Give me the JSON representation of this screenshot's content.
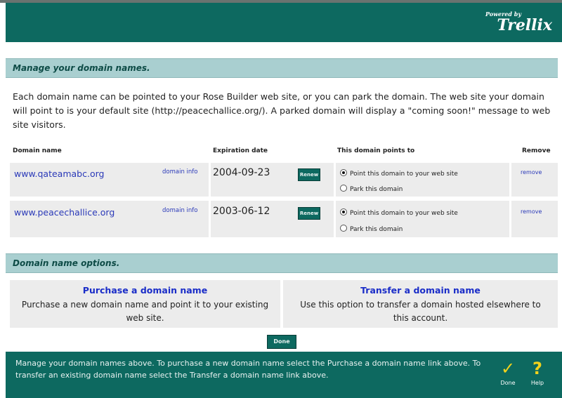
{
  "branding": {
    "powered": "Powered by",
    "brand": "Trellix"
  },
  "manage_section": {
    "title": "Manage your domain names.",
    "intro": "Each domain name can be pointed to your Rose Builder web site, or you can park the domain. The web site your domain will point to is your default site (http://peacechallice.org/). A parked domain will display a \"coming soon!\" message to web site visitors."
  },
  "table": {
    "headers": {
      "domain": "Domain name",
      "expiration": "Expiration date",
      "points": "This domain points to",
      "remove": "Remove"
    },
    "rows": [
      {
        "domain": "www.qateamabc.org",
        "info": "domain info",
        "expiration": "2004-09-23",
        "renew": "Renew",
        "option_point": "Point this domain to your web site",
        "option_park": "Park this domain",
        "selected": "point",
        "remove": "remove"
      },
      {
        "domain": "www.peacechallice.org",
        "info": "domain info",
        "expiration": "2003-06-12",
        "renew": "Renew",
        "option_point": "Point this domain to your web site",
        "option_park": "Park this domain",
        "selected": "point",
        "remove": "remove"
      }
    ]
  },
  "options_section": {
    "title": "Domain name options.",
    "purchase": {
      "title": "Purchase a domain name",
      "desc": "Purchase a new domain name and point it to your existing web site."
    },
    "transfer": {
      "title": "Transfer a domain name",
      "desc": "Use this option to transfer a domain hosted elsewhere to this account."
    }
  },
  "done_button": "Done",
  "footer": {
    "text": "Manage your domain names above. To purchase a new domain name select the Purchase a domain name link above. To transfer an existing domain name select the Transfer a domain name link above.",
    "done_label": "Done",
    "done_glyph": "✓",
    "help_label": "Help",
    "help_glyph": "?"
  },
  "colors": {
    "header_bg": "#0d6960",
    "section_bg": "#a9cfd0",
    "link": "#2a39b8",
    "icon_yellow": "#f2d21b"
  },
  "icons": [
    "check-icon",
    "help-icon"
  ]
}
